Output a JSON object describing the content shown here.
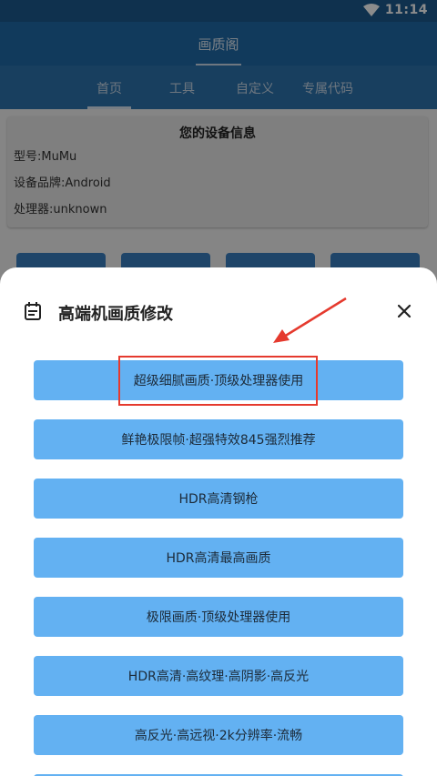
{
  "status_bar": {
    "time": "11:14"
  },
  "app": {
    "title": "画质阁"
  },
  "tabs": [
    {
      "label": "首页"
    },
    {
      "label": "工具"
    },
    {
      "label": "自定义"
    },
    {
      "label": "专属代码"
    }
  ],
  "device_info": {
    "title": "您的设备信息",
    "model": "型号:MuMu",
    "brand": "设备品牌:Android",
    "processor": "处理器:unknown"
  },
  "sheet": {
    "title": "高端机画质修改",
    "options": [
      {
        "label": "超级细腻画质·顶级处理器使用"
      },
      {
        "label": "鲜艳极限帧·超强特效845强烈推荐"
      },
      {
        "label": "HDR高清钢枪"
      },
      {
        "label": "HDR高清最高画质"
      },
      {
        "label": "极限画质·顶级处理器使用"
      },
      {
        "label": "HDR高清·高纹理·高阴影·高反光"
      },
      {
        "label": "高反光·高远视·2k分辨率·流畅"
      }
    ]
  },
  "colors": {
    "primary": "#1f6aa8",
    "option_button": "#63b1f2",
    "annotation": "#e53a2e"
  },
  "icons": [
    "wifi-icon",
    "calendar-icon",
    "close-icon"
  ]
}
